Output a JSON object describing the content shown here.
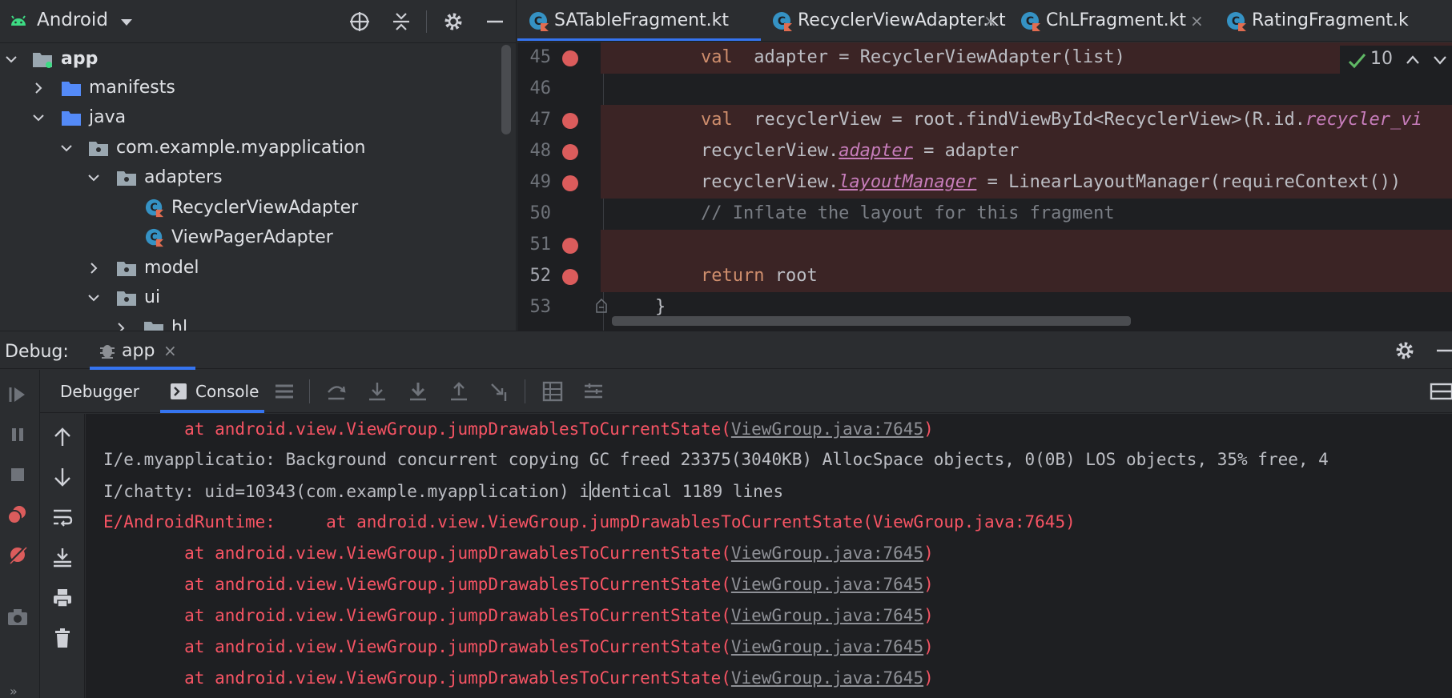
{
  "project": {
    "title": "Android",
    "tree": [
      {
        "label": "app",
        "bold": true
      },
      {
        "label": "manifests"
      },
      {
        "label": "java"
      },
      {
        "label": "com.example.myapplication"
      },
      {
        "label": "adapters"
      },
      {
        "label": "RecyclerViewAdapter"
      },
      {
        "label": "ViewPagerAdapter"
      },
      {
        "label": "model"
      },
      {
        "label": "ui"
      },
      {
        "label": "hl"
      }
    ]
  },
  "editor": {
    "tabs": [
      {
        "label": "SATableFragment.kt",
        "active": true
      },
      {
        "label": "RecyclerViewAdapter.kt"
      },
      {
        "label": "ChLFragment.kt"
      },
      {
        "label": "RatingFragment.k"
      }
    ],
    "close_glyph": "×",
    "inspection_count": "10",
    "lines": [
      {
        "no": "45",
        "parts": [
          [
            "kw",
            "val"
          ],
          [
            "",
            "  adapter = RecyclerViewAdapter(list)"
          ]
        ]
      },
      {
        "no": "46",
        "parts": []
      },
      {
        "no": "47",
        "parts": [
          [
            "kw",
            "val"
          ],
          [
            "",
            "  recyclerView = root.findViewById<RecyclerView>(R.id."
          ],
          [
            "prop",
            "recycler_vi"
          ]
        ]
      },
      {
        "no": "48",
        "parts": [
          [
            "",
            "recyclerView."
          ],
          [
            "propu",
            "adapter"
          ],
          [
            "",
            " = adapter"
          ]
        ]
      },
      {
        "no": "49",
        "parts": [
          [
            "",
            "recyclerView."
          ],
          [
            "propu",
            "layoutManager"
          ],
          [
            "",
            " = LinearLayoutManager(requireContext())"
          ]
        ]
      },
      {
        "no": "50",
        "parts": [
          [
            "cmt",
            "// Inflate the layout for this fragment"
          ]
        ]
      },
      {
        "no": "51",
        "parts": []
      },
      {
        "no": "52",
        "parts": [
          [
            "kw",
            "return"
          ],
          [
            "",
            " root"
          ]
        ]
      },
      {
        "no": "53",
        "parts": [
          [
            "",
            "}"
          ]
        ]
      }
    ]
  },
  "debug": {
    "label": "Debug:",
    "session_tab": "app",
    "tabs": {
      "debugger": "Debugger",
      "console": "Console"
    }
  },
  "console": {
    "lines": [
      {
        "kind": "trace",
        "prefix": "        at android.view.ViewGroup.jumpDrawablesToCurrentState(",
        "link": "ViewGroup.java:7645",
        "suffix": ")"
      },
      {
        "kind": "info",
        "text": "I/e.myapplicatio: Background concurrent copying GC freed 23375(3040KB) AllocSpace objects, 0(0B) LOS objects, 35% free, 4"
      },
      {
        "kind": "info",
        "text_before_caret": "I/chatty: uid=10343(com.example.myapplication) i",
        "text_after_caret": "dentical 1189 lines"
      },
      {
        "kind": "error",
        "text": "E/AndroidRuntime:     at android.view.ViewGroup.jumpDrawablesToCurrentState(ViewGroup.java:7645)"
      },
      {
        "kind": "trace",
        "prefix": "        at android.view.ViewGroup.jumpDrawablesToCurrentState(",
        "link": "ViewGroup.java:7645",
        "suffix": ")"
      },
      {
        "kind": "trace",
        "prefix": "        at android.view.ViewGroup.jumpDrawablesToCurrentState(",
        "link": "ViewGroup.java:7645",
        "suffix": ")"
      },
      {
        "kind": "trace",
        "prefix": "        at android.view.ViewGroup.jumpDrawablesToCurrentState(",
        "link": "ViewGroup.java:7645",
        "suffix": ")"
      },
      {
        "kind": "trace",
        "prefix": "        at android.view.ViewGroup.jumpDrawablesToCurrentState(",
        "link": "ViewGroup.java:7645",
        "suffix": ")"
      },
      {
        "kind": "trace",
        "prefix": "        at android.view.ViewGroup.jumpDrawablesToCurrentState(",
        "link": "ViewGroup.java:7645",
        "suffix": ")"
      }
    ]
  },
  "colors": {
    "accent": "#3574f0",
    "breakpoint": "#db5c5c",
    "error_text": "#f75464",
    "keyword": "#cf8e6d",
    "property": "#c77dbb"
  },
  "icons": [
    "android-icon",
    "crosshair-icon",
    "collapse-all-icon",
    "gear-icon",
    "minimize-icon",
    "folder-icon",
    "package-icon",
    "kotlin-class-icon",
    "bug-icon",
    "resume-icon",
    "pause-icon",
    "stop-icon",
    "breakpoints-icon",
    "mute-breakpoints-icon",
    "camera-icon",
    "arrow-up-icon",
    "arrow-down-icon",
    "soft-wrap-icon",
    "scroll-end-icon",
    "print-icon",
    "trash-icon",
    "step-over-icon",
    "step-into-icon",
    "force-step-into-icon",
    "step-out-icon",
    "run-to-cursor-icon",
    "evaluate-icon",
    "trace-icon",
    "threads-icon",
    "layout-icon"
  ]
}
